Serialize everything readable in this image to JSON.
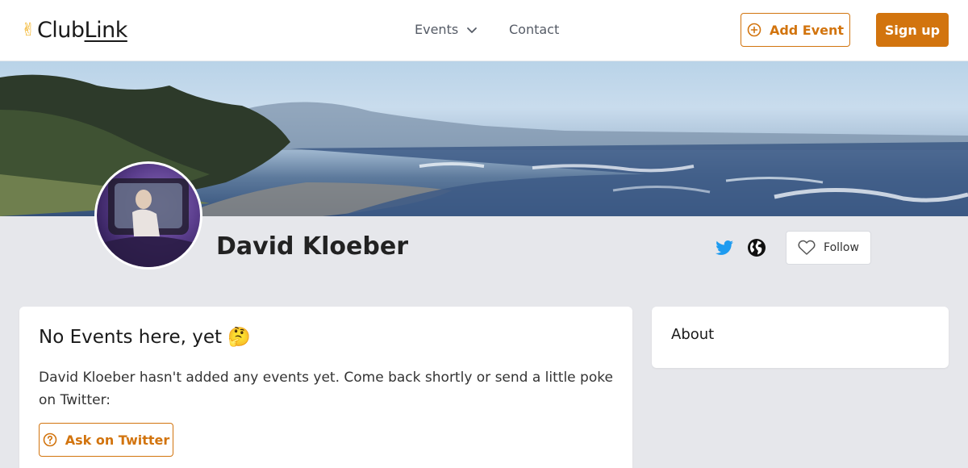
{
  "header": {
    "logo_emoji": "✌",
    "logo_club": "Club",
    "logo_link": "Link",
    "nav": {
      "events_label": "Events",
      "contact_label": "Contact"
    },
    "add_event_label": "Add Event",
    "signup_label": "Sign up"
  },
  "profile": {
    "name": "David Kloeber",
    "follow_label": "Follow",
    "social_links": [
      "twitter-icon",
      "globe-icon"
    ]
  },
  "events_card": {
    "title": "No Events here, yet 🤔",
    "message": "David Kloeber hasn't added any events yet. Come back shortly or send a little poke on Twitter:",
    "ask_button_label": "Ask on Twitter"
  },
  "about_card": {
    "title": "About"
  },
  "colors": {
    "accent": "#d2740e",
    "twitter": "#1d9bf0",
    "page_bg": "#e6e7eb"
  }
}
